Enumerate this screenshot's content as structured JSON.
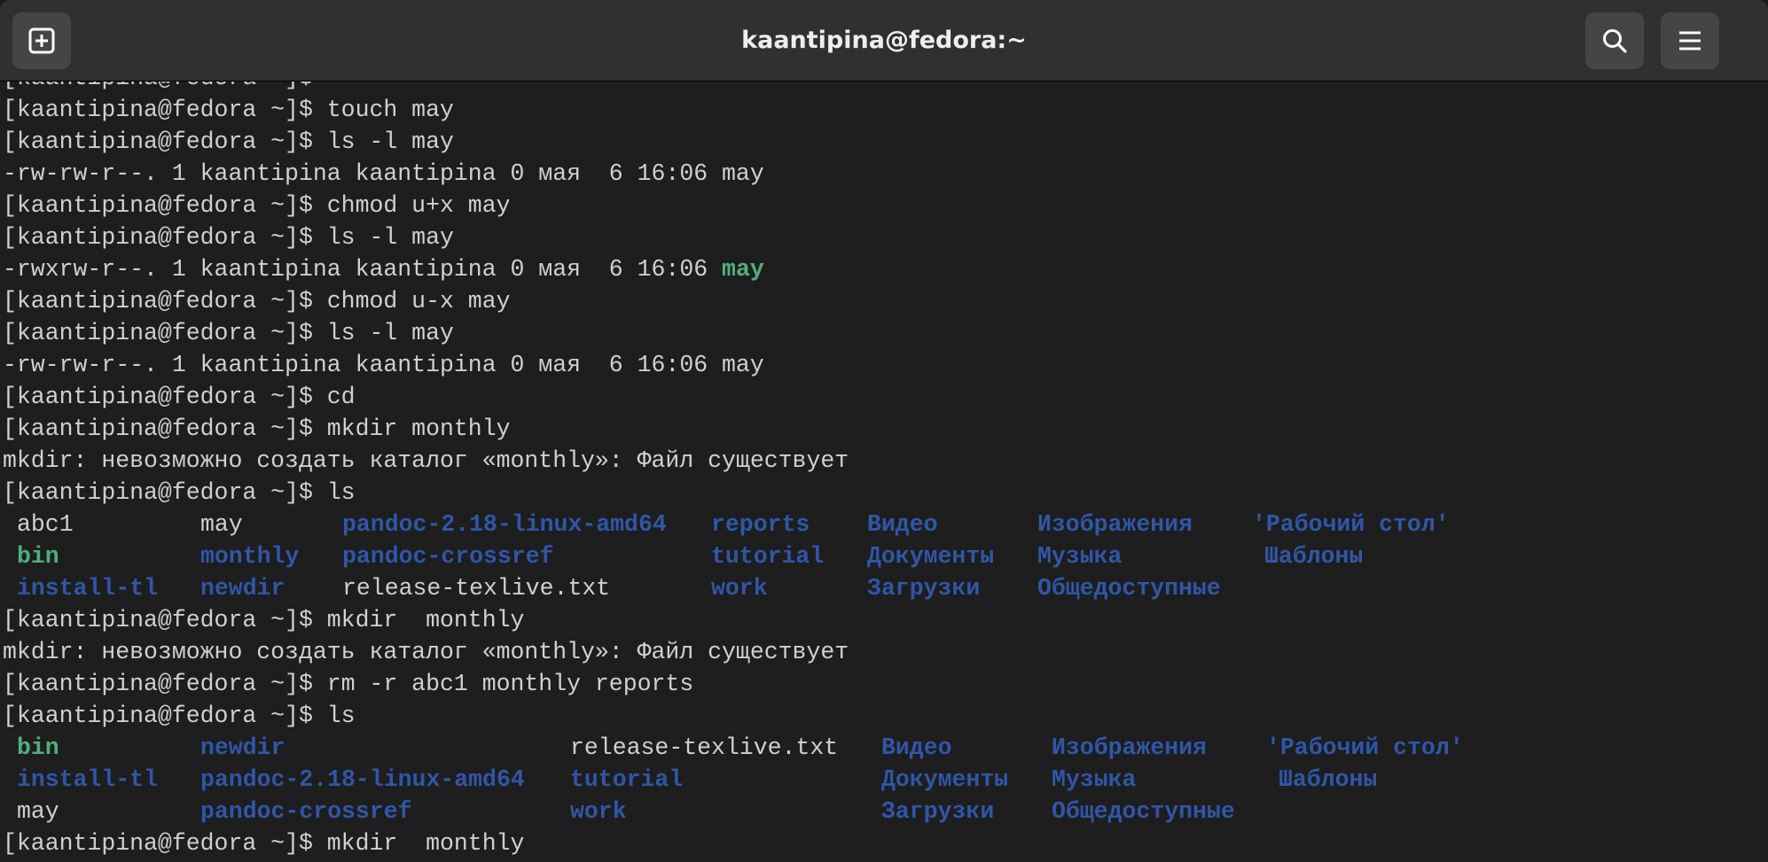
{
  "window": {
    "title": "kaantipina@fedora:~"
  },
  "icons": {
    "new_tab": "new-tab-icon",
    "search": "search-icon",
    "menu": "hamburger-menu-icon"
  },
  "colors": {
    "background": "#1e1e1e",
    "titlebar": "#303030",
    "text": "#d0d0d0",
    "executable": "#4fb07a",
    "directory": "#2f56a8"
  },
  "terminal": {
    "partial_top": "[kaantipina@fedora ~]$",
    "lines": [
      "[kaantipina@fedora ~]$ touch may",
      "[kaantipina@fedora ~]$ ls -l may",
      "-rw-rw-r--. 1 kaantipina kaantipina 0 мая  6 16:06 may",
      "[kaantipina@fedora ~]$ chmod u+x may",
      "[kaantipina@fedora ~]$ ls -l may",
      "-rwxrw-r--. 1 kaantipina kaantipina 0 мая  6 16:06 ",
      "[kaantipina@fedora ~]$ chmod u-x may",
      "[kaantipina@fedora ~]$ ls -l may",
      "-rw-rw-r--. 1 kaantipina kaantipina 0 мая  6 16:06 may",
      "[kaantipina@fedora ~]$ cd",
      "[kaantipina@fedora ~]$ mkdir monthly",
      "mkdir: невозможно создать каталог «monthly»: Файл существует",
      "[kaantipina@fedora ~]$ ls"
    ],
    "exec_highlight": "may",
    "ls1": {
      "col1": [
        "abc1",
        "bin",
        "install-tl"
      ],
      "col2": [
        "may",
        "monthly",
        "newdir"
      ],
      "col3": [
        "pandoc-2.18-linux-amd64",
        "pandoc-crossref",
        "release-texlive.txt"
      ],
      "col4": [
        "reports",
        "tutorial",
        "work"
      ],
      "col5": [
        "Видео",
        "Документы",
        "Загрузки"
      ],
      "col6": [
        "Изображения",
        "Музыка",
        "Общедоступные"
      ],
      "col7": [
        "'Рабочий стол'",
        "Шаблоны"
      ]
    },
    "lines2": [
      "[kaantipina@fedora ~]$ mkdir  monthly",
      "mkdir: невозможно создать каталог «monthly»: Файл существует",
      "[kaantipina@fedora ~]$ rm -r abc1 monthly reports",
      "[kaantipina@fedora ~]$ ls"
    ],
    "ls2": {
      "col1": [
        "bin",
        "install-tl",
        "may"
      ],
      "col2": [
        "newdir",
        "pandoc-2.18-linux-amd64",
        "pandoc-crossref"
      ],
      "col3": [
        "release-texlive.txt",
        "tutorial",
        "work"
      ],
      "col4": [
        "Видео",
        "Документы",
        "Загрузки"
      ],
      "col5": [
        "Изображения",
        "Музыка",
        "Общедоступные"
      ],
      "col6": [
        "'Рабочий стол'",
        "Шаблоны"
      ]
    },
    "last_line": "[kaantipina@fedora ~]$ mkdir  monthly"
  }
}
